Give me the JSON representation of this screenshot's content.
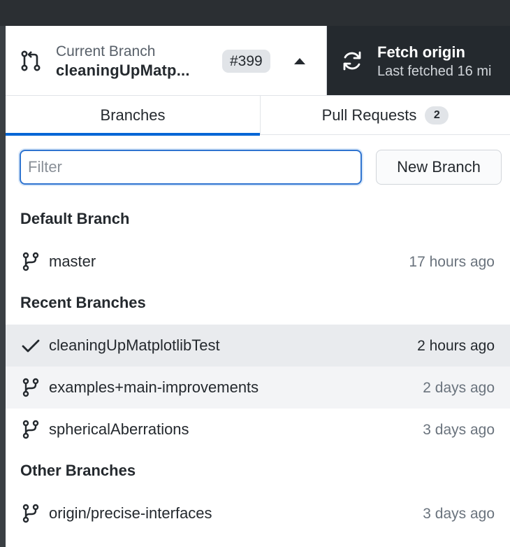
{
  "toolbar": {
    "current_branch": {
      "caption": "Current Branch",
      "name": "cleaningUpMatp...",
      "pr_number": "#399",
      "icon": "pull-request-icon"
    },
    "fetch": {
      "title": "Fetch origin",
      "subtitle": "Last fetched 16 mi",
      "icon": "sync-icon"
    }
  },
  "tabs": [
    {
      "label": "Branches",
      "active": true
    },
    {
      "label": "Pull Requests",
      "count": "2",
      "active": false
    }
  ],
  "filter": {
    "placeholder": "Filter",
    "value": ""
  },
  "new_branch_label": "New Branch",
  "sections": {
    "default": {
      "title": "Default Branch",
      "items": [
        {
          "name": "master",
          "time": "17 hours ago",
          "icon": "git-branch-icon"
        }
      ]
    },
    "recent": {
      "title": "Recent Branches",
      "items": [
        {
          "name": "cleaningUpMatplotlibTest",
          "time": "2 hours ago",
          "icon": "check-icon",
          "selected": true
        },
        {
          "name": "examples+main-improvements",
          "time": "2 days ago",
          "icon": "git-branch-icon"
        },
        {
          "name": "sphericalAberrations",
          "time": "3 days ago",
          "icon": "git-branch-icon"
        }
      ]
    },
    "other": {
      "title": "Other Branches",
      "items": [
        {
          "name": "origin/precise-interfaces",
          "time": "3 days ago",
          "icon": "git-branch-icon"
        }
      ]
    }
  },
  "colors": {
    "accent": "#0366d6",
    "dark_toolbar": "#24292e",
    "selected_row": "#e9ebee"
  }
}
